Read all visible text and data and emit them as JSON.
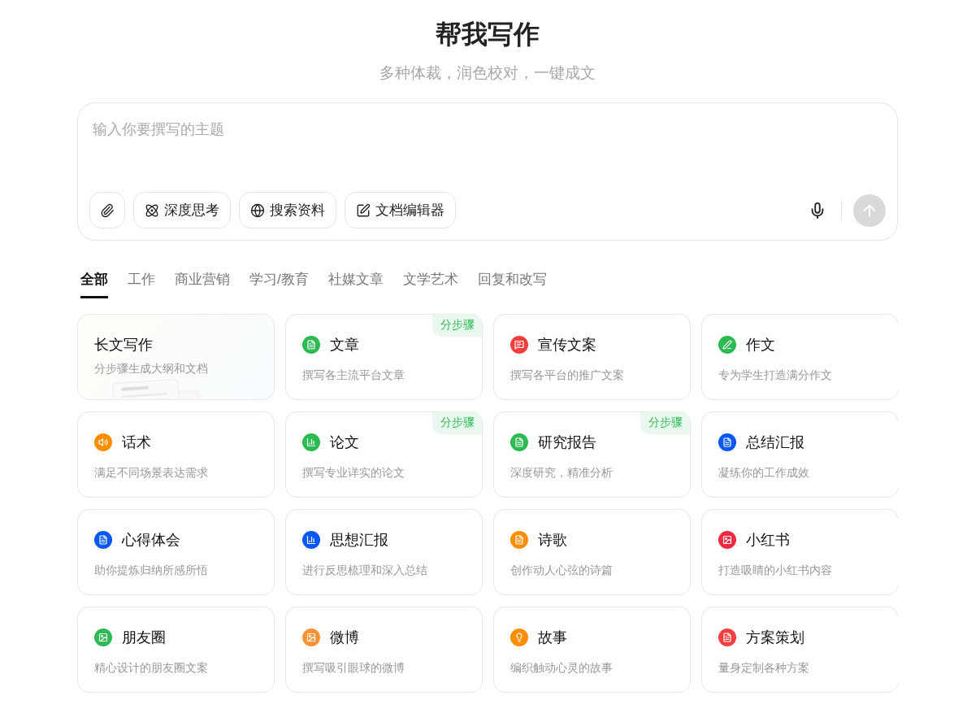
{
  "header": {
    "title": "帮我写作",
    "subtitle": "多种体裁，润色校对，一键成文"
  },
  "composer": {
    "placeholder": "输入你要撰写的主题",
    "tools": [
      {
        "kind": "attach"
      },
      {
        "kind": "think",
        "label": "深度思考"
      },
      {
        "kind": "search",
        "label": "搜索资料"
      },
      {
        "kind": "editor",
        "label": "文档编辑器"
      }
    ],
    "send_disabled": true
  },
  "tabs": [
    {
      "label": "全部",
      "selected": true
    },
    {
      "label": "工作",
      "selected": false
    },
    {
      "label": "商业营销",
      "selected": false
    },
    {
      "label": "学习/教育",
      "selected": false
    },
    {
      "label": "社媒文章",
      "selected": false
    },
    {
      "label": "文学艺术",
      "selected": false
    },
    {
      "label": "回复和改写",
      "selected": false
    }
  ],
  "cards": [
    {
      "kind": "feature",
      "title": "长文写作",
      "desc": "分步骤生成大纲和文档"
    },
    {
      "kind": "doc",
      "title": "文章",
      "desc": "撰写各主流平台文章",
      "color": "#2dba52",
      "badge": "分步骤"
    },
    {
      "kind": "chat",
      "title": "宣传文案",
      "desc": "撰写各平台的推广文案",
      "color": "#f53f3f"
    },
    {
      "kind": "pen",
      "title": "作文",
      "desc": "专为学生打造满分作文",
      "color": "#2dba52"
    },
    {
      "kind": "voice",
      "title": "话术",
      "desc": "满足不同场景表达需求",
      "color": "#ff8f00"
    },
    {
      "kind": "chart",
      "title": "论文",
      "desc": "撰写专业详实的论文",
      "color": "#2dba52",
      "badge": "分步骤"
    },
    {
      "kind": "doc",
      "title": "研究报告",
      "desc": "深度研究，精准分析",
      "color": "#2dba52",
      "badge": "分步骤"
    },
    {
      "kind": "doc",
      "title": "总结汇报",
      "desc": "凝练你的工作成效",
      "color": "#0957f5"
    },
    {
      "kind": "doc",
      "title": "心得体会",
      "desc": "助你提炼归纳所感所悟",
      "color": "#0957f5"
    },
    {
      "kind": "chart",
      "title": "思想汇报",
      "desc": "进行反思梳理和深入总结",
      "color": "#0957f5"
    },
    {
      "kind": "doc",
      "title": "诗歌",
      "desc": "创作动人心弦的诗篇",
      "color": "#ff8f00"
    },
    {
      "kind": "image",
      "title": "小红书",
      "desc": "打造吸睛的小红书内容",
      "color": "#f5293f"
    },
    {
      "kind": "image",
      "title": "朋友圈",
      "desc": "精心设计的朋友圈文案",
      "color": "#2dba52"
    },
    {
      "kind": "image",
      "title": "微博",
      "desc": "撰写吸引眼球的微博",
      "color": "#ff9233"
    },
    {
      "kind": "bulb",
      "title": "故事",
      "desc": "编织触动心灵的故事",
      "color": "#ff8f00"
    },
    {
      "kind": "doc",
      "title": "方案策划",
      "desc": "量身定制各种方案",
      "color": "#f53f3f"
    }
  ]
}
